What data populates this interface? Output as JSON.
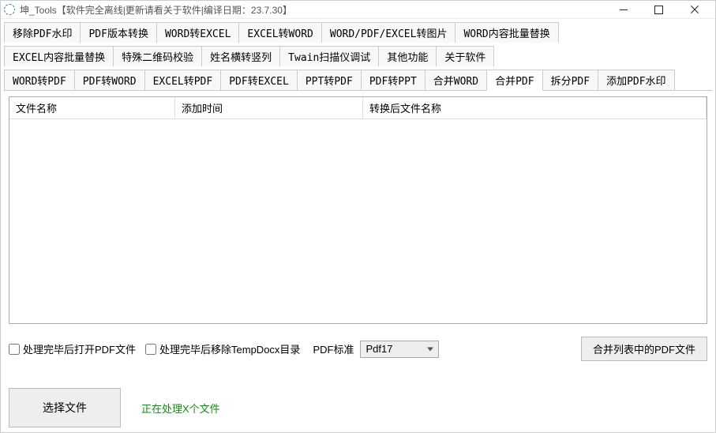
{
  "window": {
    "title": "坤_Tools【软件完全离线|更新请看关于软件|编译日期：23.7.30】"
  },
  "tabRow1": [
    "移除PDF水印",
    "PDF版本转换",
    "WORD转EXCEL",
    "EXCEL转WORD",
    "WORD/PDF/EXCEL转图片",
    "WORD内容批量替换"
  ],
  "tabRow2": [
    "EXCEL内容批量替换",
    "特殊二维码校验",
    "姓名横转竖列",
    "Twain扫描仪调试",
    "其他功能",
    "关于软件"
  ],
  "tabRow3": [
    "WORD转PDF",
    "PDF转WORD",
    "EXCEL转PDF",
    "PDF转EXCEL",
    "PPT转PDF",
    "PDF转PPT",
    "合并WORD",
    "合并PDF",
    "拆分PDF",
    "添加PDF水印"
  ],
  "activeTab": "合并PDF",
  "columns": {
    "c1": "文件名称",
    "c2": "添加时间",
    "c3": "转换后文件名称"
  },
  "opts": {
    "openAfter": "处理完毕后打开PDF文件",
    "removeTemp": "处理完毕后移除TempDocx目录",
    "pdfStdLabel": "PDF标准",
    "pdfStdValue": "Pdf17",
    "mergeBtn": "合并列表中的PDF文件"
  },
  "action": {
    "choose": "选择文件",
    "status": "正在处理X个文件"
  }
}
